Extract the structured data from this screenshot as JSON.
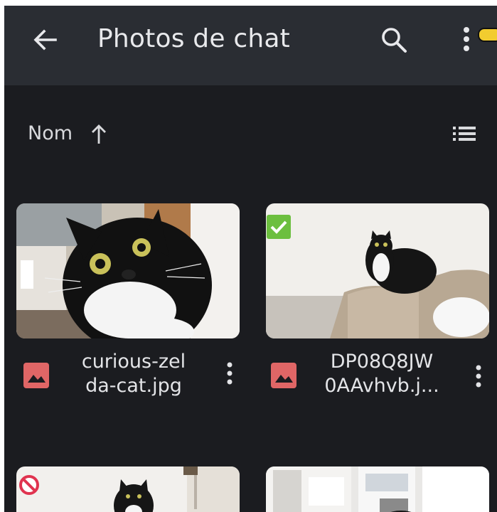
{
  "app": {
    "title": "Photos de chat"
  },
  "toolbar": {
    "icons": [
      "arrow-back-icon",
      "search-icon",
      "more-vert-icon"
    ]
  },
  "sort": {
    "label": "Nom",
    "direction": "ascending",
    "view_icon": "list-view-icon"
  },
  "colors": {
    "background": "#1b1c20",
    "appbar": "#2a2d33",
    "image_icon": "#e06666",
    "check_badge": "#6cbf3f",
    "blocked_badge": "#e0334f"
  },
  "files": [
    {
      "name_line1": "curious-zel",
      "name_line2": "da-cat.jpg",
      "type_icon": "image-file-icon",
      "state": "normal"
    },
    {
      "name_line1": "DP08Q8JW",
      "name_line2": "0AAvhvb.j...",
      "type_icon": "image-file-icon",
      "state": "selected"
    },
    {
      "name_line1": "",
      "name_line2": "",
      "type_icon": "image-file-icon",
      "state": "blocked"
    },
    {
      "name_line1": "",
      "name_line2": "",
      "type_icon": "image-file-icon",
      "state": "normal"
    }
  ]
}
